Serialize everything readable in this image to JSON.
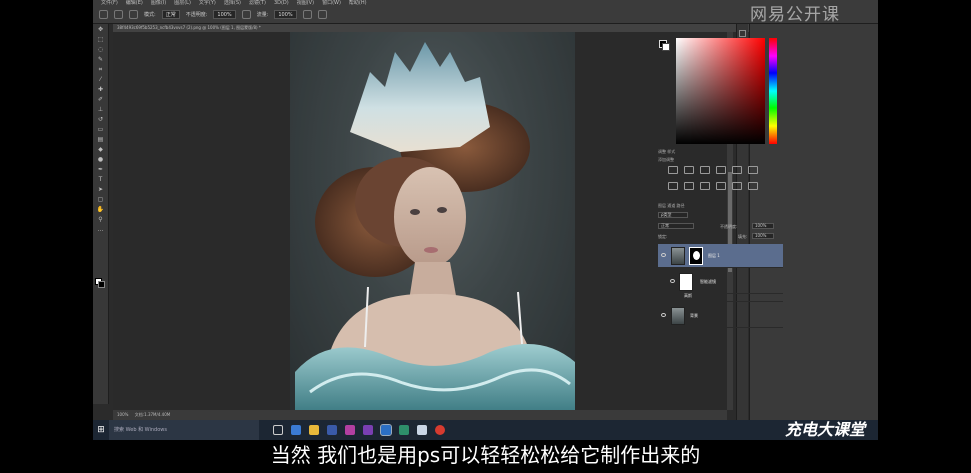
{
  "menu": {
    "items": [
      "文件(F)",
      "编辑(E)",
      "图像(I)",
      "图层(L)",
      "文字(Y)",
      "选择(S)",
      "滤镜(T)",
      "3D(D)",
      "视图(V)",
      "窗口(W)",
      "帮助(H)"
    ]
  },
  "options_bar": {
    "mode_label": "模式:",
    "mode_value": "正常",
    "opacity_label": "不透明度:",
    "opacity_value": "100%",
    "flow_label": "流量:",
    "flow_value": "100%"
  },
  "document": {
    "tab_title": "38f4493c69f5b5253_ncfb43vxvs7 (2).png @ 100% (图层 1, 图层蒙版/8) *",
    "zoom": "100%",
    "doc_info": "文档:1.37M/4.40M"
  },
  "watermark": "网易公开课",
  "panels": {
    "tabs_adjust": "调整   样式",
    "adjust_title": "添加调整",
    "layer_tabs": "图层   通道   路径",
    "kind_label": "ρ类型",
    "blend_mode": "正常",
    "opacity_label": "不透明度:",
    "opacity_value": "100%",
    "lock_label": "锁定:",
    "fill_label": "填充:",
    "fill_value": "100%",
    "layers": [
      {
        "name": "图层 1",
        "selected": true,
        "has_mask": true
      },
      {
        "name": "智能滤镜",
        "selected": false,
        "has_mask": false
      },
      {
        "name": "高斯",
        "selected": false,
        "has_mask": false
      },
      {
        "name": "背景",
        "selected": false,
        "has_mask": false
      }
    ]
  },
  "taskbar": {
    "search_placeholder": "搜索 Web 和 Windows"
  },
  "brand": "充电大课堂",
  "subtitle": "当然 我们也是用ps可以轻轻松松给它制作出来的"
}
